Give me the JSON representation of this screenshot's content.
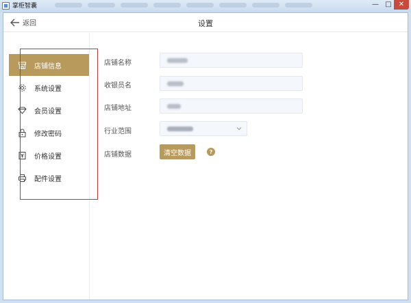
{
  "window": {
    "title": "掌柜智囊",
    "minimize_label": "—",
    "maximize_label": "□",
    "close_label": "✕"
  },
  "header": {
    "back_label": "返回",
    "title": "设置"
  },
  "sidebar": {
    "items": [
      {
        "label": "店铺信息",
        "icon": "store-icon",
        "active": true
      },
      {
        "label": "系统设置",
        "icon": "gear-icon",
        "active": false
      },
      {
        "label": "会员设置",
        "icon": "diamond-icon",
        "active": false
      },
      {
        "label": "修改密码",
        "icon": "lock-icon",
        "active": false
      },
      {
        "label": "价格设置",
        "icon": "price-tag-icon",
        "active": false
      },
      {
        "label": "配件设置",
        "icon": "printer-icon",
        "active": false
      }
    ]
  },
  "form": {
    "store_name_label": "店铺名称",
    "cashier_label": "收银员名",
    "address_label": "店铺地址",
    "industry_label": "行业范围",
    "data_label": "店铺数据",
    "clear_button_label": "清空数据",
    "help_label": "?"
  },
  "colors": {
    "accent": "#b89a5c",
    "highlight_border": "#d0312d"
  }
}
